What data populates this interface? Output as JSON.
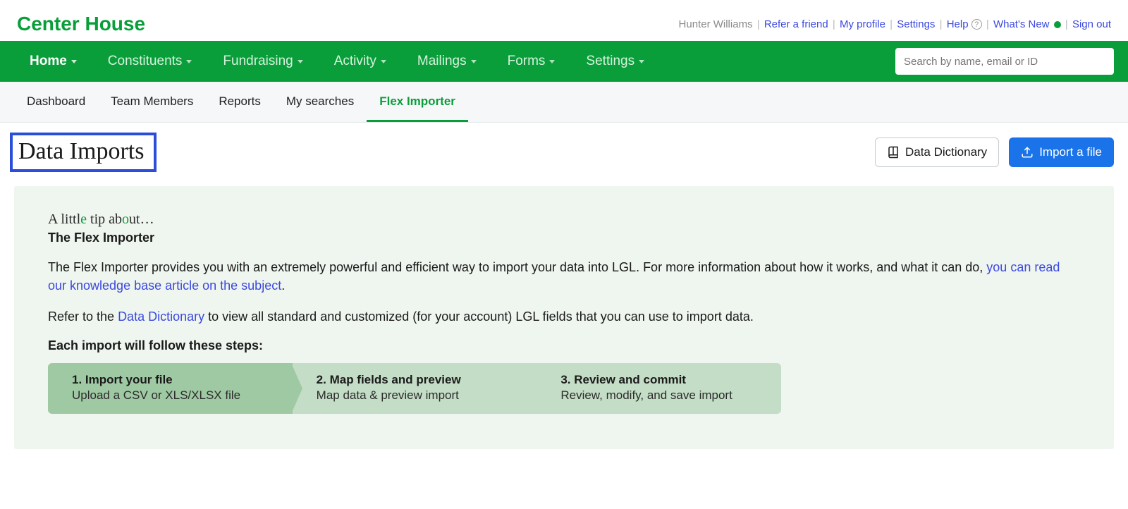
{
  "brand": "Center House",
  "user": {
    "name": "Hunter Williams",
    "links": {
      "refer": "Refer a friend",
      "profile": "My profile",
      "settings": "Settings",
      "help": "Help",
      "whatsnew": "What's New",
      "signout": "Sign out"
    }
  },
  "mainnav": {
    "home": "Home",
    "constituents": "Constituents",
    "fundraising": "Fundraising",
    "activity": "Activity",
    "mailings": "Mailings",
    "forms": "Forms",
    "settings": "Settings",
    "search_placeholder": "Search by name, email or ID"
  },
  "subnav": {
    "dashboard": "Dashboard",
    "team": "Team Members",
    "reports": "Reports",
    "searches": "My searches",
    "flex": "Flex Importer"
  },
  "page": {
    "title": "Data Imports",
    "btn_dict": "Data Dictionary",
    "btn_import": "Import a file"
  },
  "tip": {
    "intro_pre": "A littl",
    "intro_e": "e",
    "intro_mid": " tip ab",
    "intro_o": "o",
    "intro_post": "ut…",
    "title": "The Flex Importer",
    "body1_a": "The Flex Importer provides you with an extremely powerful and efficient way to import your data into LGL. For more information about how it works, and what it can do, ",
    "body1_link": "you can read our knowledge base article on the subject",
    "body1_b": ".",
    "body2_a": "Refer to the ",
    "body2_link": "Data Dictionary",
    "body2_b": " to view all standard and customized (for your account) LGL fields that you can use to import data.",
    "steps_title": "Each import will follow these steps:",
    "steps": {
      "s1_title": "1. Import your file",
      "s1_sub": "Upload a CSV or XLS/XLSX file",
      "s2_title": "2. Map fields and preview",
      "s2_sub": "Map data & preview import",
      "s3_title": "3. Review and commit",
      "s3_sub": "Review, modify, and save import"
    }
  }
}
